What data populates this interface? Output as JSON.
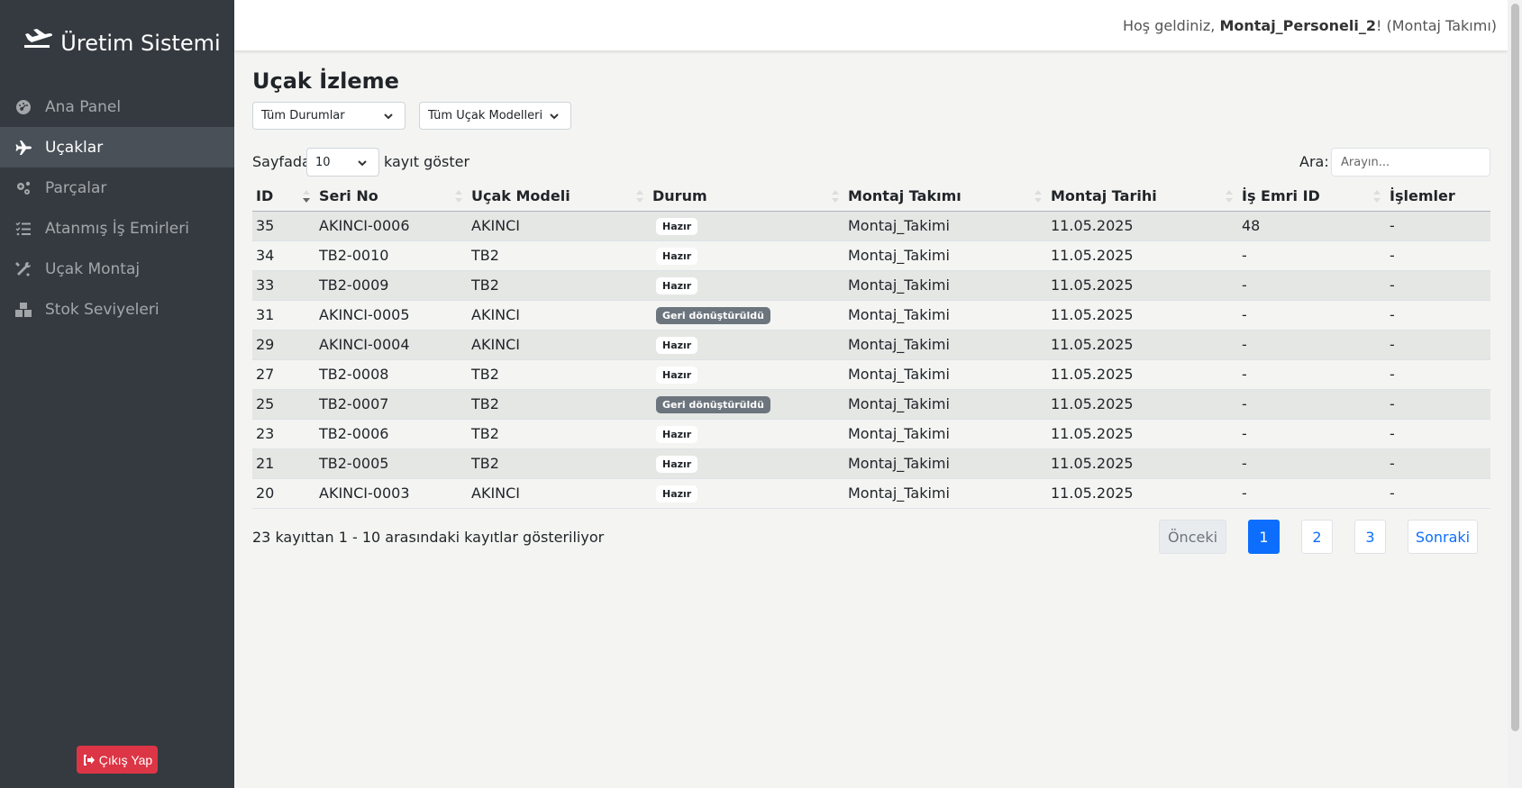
{
  "app": {
    "brand": "Üretim Sistemi"
  },
  "sidebar": {
    "items": [
      {
        "label": "Ana Panel",
        "icon": "gauge-icon"
      },
      {
        "label": "Uçaklar",
        "icon": "plane-icon",
        "active": true
      },
      {
        "label": "Parçalar",
        "icon": "gears-icon"
      },
      {
        "label": "Atanmış İş Emirleri",
        "icon": "list-check-icon"
      },
      {
        "label": "Uçak Montaj",
        "icon": "tools-icon"
      },
      {
        "label": "Stok Seviyeleri",
        "icon": "boxes-icon"
      }
    ],
    "logout_label": "Çıkış Yap"
  },
  "topbar": {
    "welcome_prefix": "Hoş geldiniz, ",
    "username": "Montaj_Personeli_2",
    "welcome_suffix": "! (Montaj Takımı)"
  },
  "page": {
    "title": "Uçak İzleme",
    "status_filter": "Tüm Durumlar",
    "model_filter": "Tüm Uçak Modelleri",
    "length_prefix": "Sayfada",
    "length_value": "10",
    "length_suffix": "kayıt göster",
    "search_label": "Ara:",
    "search_placeholder": "Arayın..."
  },
  "table": {
    "columns": [
      "ID",
      "Seri No",
      "Uçak Modeli",
      "Durum",
      "Montaj Takımı",
      "Montaj Tarihi",
      "İş Emri ID",
      "İşlemler"
    ],
    "rows": [
      [
        "35",
        "AKINCI-0006",
        "AKINCI",
        "Hazır",
        "Montaj_Takimi",
        "11.05.2025",
        "48",
        "-"
      ],
      [
        "34",
        "TB2-0010",
        "TB2",
        "Hazır",
        "Montaj_Takimi",
        "11.05.2025",
        "-",
        "-"
      ],
      [
        "33",
        "TB2-0009",
        "TB2",
        "Hazır",
        "Montaj_Takimi",
        "11.05.2025",
        "-",
        "-"
      ],
      [
        "31",
        "AKINCI-0005",
        "AKINCI",
        "Geri dönüştürüldü",
        "Montaj_Takimi",
        "11.05.2025",
        "-",
        "-"
      ],
      [
        "29",
        "AKINCI-0004",
        "AKINCI",
        "Hazır",
        "Montaj_Takimi",
        "11.05.2025",
        "-",
        "-"
      ],
      [
        "27",
        "TB2-0008",
        "TB2",
        "Hazır",
        "Montaj_Takimi",
        "11.05.2025",
        "-",
        "-"
      ],
      [
        "25",
        "TB2-0007",
        "TB2",
        "Geri dönüştürüldü",
        "Montaj_Takimi",
        "11.05.2025",
        "-",
        "-"
      ],
      [
        "23",
        "TB2-0006",
        "TB2",
        "Hazır",
        "Montaj_Takimi",
        "11.05.2025",
        "-",
        "-"
      ],
      [
        "21",
        "TB2-0005",
        "TB2",
        "Hazır",
        "Montaj_Takimi",
        "11.05.2025",
        "-",
        "-"
      ],
      [
        "20",
        "AKINCI-0003",
        "AKINCI",
        "Hazır",
        "Montaj_Takimi",
        "11.05.2025",
        "-",
        "-"
      ]
    ],
    "status_styles": {
      "Hazır": "light",
      "Geri dönüştürüldü": "gray"
    }
  },
  "footer": {
    "info": "23 kayıttan 1 - 10 arasındaki kayıtlar gösteriliyor",
    "prev": "Önceki",
    "pages": [
      "1",
      "2",
      "3"
    ],
    "next": "Sonraki",
    "current_page": "1"
  }
}
